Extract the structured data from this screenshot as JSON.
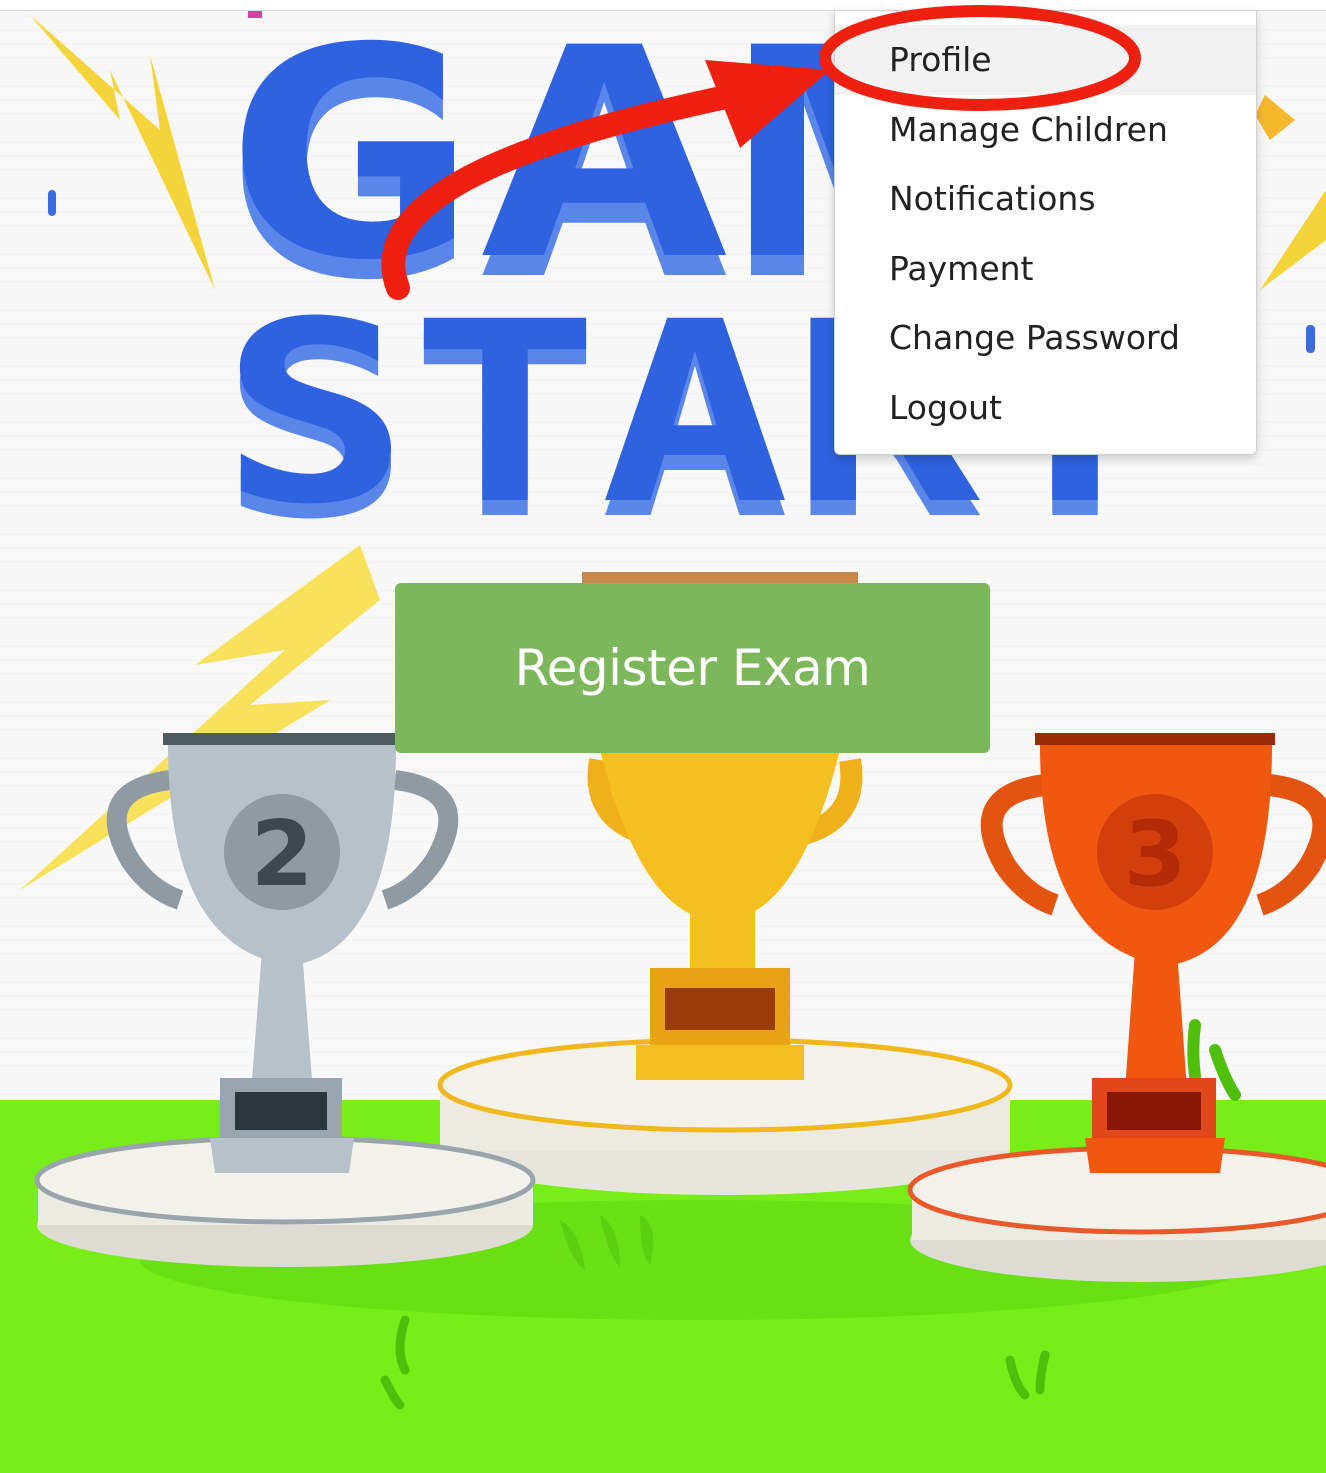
{
  "menu": {
    "items": [
      {
        "label": "Profile"
      },
      {
        "label": "Manage Children"
      },
      {
        "label": "Notifications"
      },
      {
        "label": "Payment"
      },
      {
        "label": "Change Password"
      },
      {
        "label": "Logout"
      }
    ]
  },
  "main": {
    "register_label": "Register Exam",
    "title_line1": "GAME",
    "title_line2": "START",
    "trophy_left_number": "2",
    "trophy_right_number": "3"
  },
  "colors": {
    "register_button": "#7cb75c",
    "title_blue": "#2f62e0",
    "grass_green": "#77ee18",
    "annotation_red": "#f02010"
  }
}
